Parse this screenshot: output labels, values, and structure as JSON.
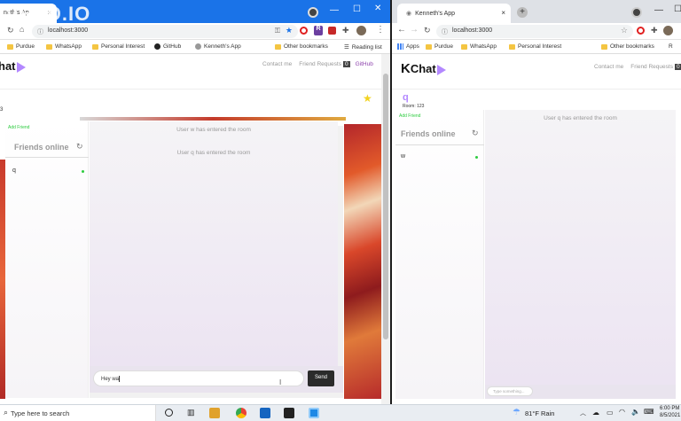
{
  "left_window": {
    "tab_title": "neth's Ap",
    "url": "localhost:3000",
    "bookmarks": [
      "Purdue",
      "WhatsApp",
      "Personal Interest",
      "GitHub",
      "Kenneth's App",
      "Other bookmarks",
      "Reading list"
    ],
    "logo_text": "hat",
    "nav": [
      "Contact me",
      "Friend Requests",
      "GitHub"
    ],
    "nav_badge": "0",
    "room_fragment": "3",
    "add_friend": "Add Friend",
    "friends_title": "Friends online",
    "friends": [
      {
        "name": "q",
        "online": true
      }
    ],
    "messages": [
      "User w has entered the room",
      "User q has entered the room"
    ],
    "input_value": "Hey wa",
    "send_label": "Send",
    "watermark": "VEED.IO"
  },
  "right_window": {
    "tab_title": "Kenneth's App",
    "url": "localhost:3000",
    "bookmarks": [
      "Apps",
      "Purdue",
      "WhatsApp",
      "Personal Interest",
      "Other bookmarks",
      "R"
    ],
    "logo_text": "Chat",
    "logo_k": "K",
    "nav": [
      "Contact me",
      "Friend Requests"
    ],
    "nav_badge": "0",
    "username": "q",
    "room": "Room: 123",
    "add_friend": "Add Friend",
    "friends_title": "Friends online",
    "friends": [
      {
        "name": "w",
        "online": true
      }
    ],
    "messages": [
      "User q has entered the room"
    ],
    "input_placeholder": "Type something..."
  },
  "taskbar": {
    "search_placeholder": "Type here to search",
    "weather": "81°F  Rain",
    "time": "6:00 PM",
    "date": "8/5/2021"
  },
  "colors": {
    "accent": "#b388ff",
    "online": "#2ecc40",
    "chrome_blue": "#1a73e8"
  }
}
